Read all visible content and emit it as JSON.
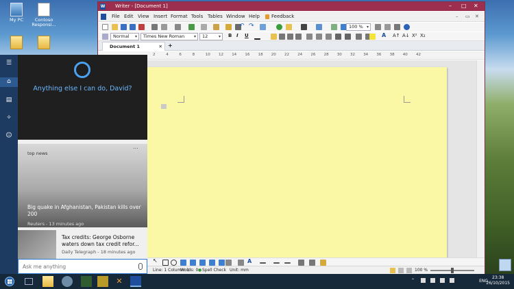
{
  "desktop": {
    "icons": [
      {
        "label": "My PC",
        "kind": "pc"
      },
      {
        "label": "Contoso Responsi...",
        "kind": "doc"
      },
      {
        "label": "",
        "kind": "folder"
      },
      {
        "label": "",
        "kind": "folder"
      }
    ]
  },
  "writer": {
    "title": "Writer - [Document 1]",
    "menu": [
      "File",
      "Edit",
      "View",
      "Insert",
      "Format",
      "Tools",
      "Tables",
      "Window",
      "Help",
      "Feedback"
    ],
    "zoom": "100 %",
    "style": "Normal",
    "font": "Times New Roman",
    "size": "12",
    "format_buttons": [
      "B",
      "I",
      "U"
    ],
    "tab_label": "Document 1",
    "ruler_labels": [
      "2",
      "4",
      "6",
      "8",
      "10",
      "12",
      "14",
      "16",
      "18",
      "20",
      "22",
      "24",
      "26",
      "28",
      "30",
      "32",
      "34",
      "36",
      "38",
      "40",
      "42"
    ],
    "status": {
      "position": "Line: 1 Column: 1",
      "words": "Words: 0",
      "spell": "Spell Check",
      "unit": "Unit: mm",
      "zoom": "100 %"
    }
  },
  "cortana": {
    "greeting": "Anything else I can do, David?",
    "section": "top news",
    "more": "...",
    "story1": {
      "headline": "Big quake in Afghanistan, Pakistan kills over 200",
      "source": "Reuters - 13 minutes ago"
    },
    "story2": {
      "headline": "Tax credits: George Osborne waters down tax credit refor...",
      "source": "Daily Telegraph - 18 minutes ago"
    },
    "search_placeholder": "Ask me anything"
  },
  "taskbar": {
    "lang": "ENG",
    "time": "23:38",
    "date": "26/10/2015"
  },
  "colors": {
    "titlebar": "#9c2f4f",
    "page": "#fbf8a5",
    "cortana_accent": "#4aa3f0",
    "rail": "#1d3a61"
  }
}
